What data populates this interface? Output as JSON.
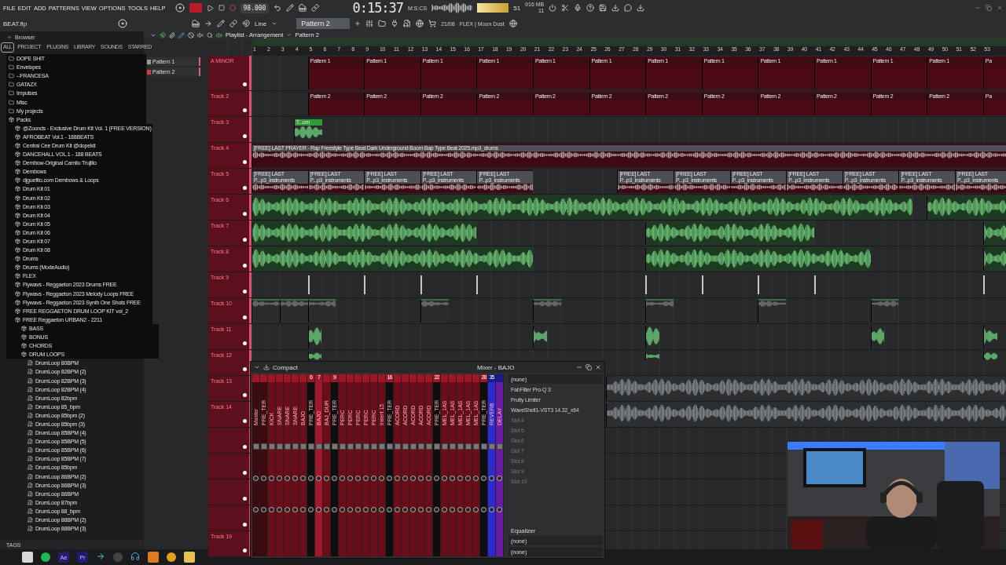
{
  "menu": [
    "FILE",
    "EDIT",
    "ADD",
    "PATTERNS",
    "VIEW",
    "OPTIONS",
    "TOOLS",
    "HELP"
  ],
  "tempo": "98.000",
  "time": "0:15:37",
  "time_unit": "M:S:CS",
  "cpu": "51",
  "memory": "916 MB",
  "polyphony": "11",
  "project": "BEAT.flp",
  "snap": "Line",
  "pattern": "Pattern 2",
  "hint_date": "21/08",
  "hint_text": "FLEX | Moon Dust",
  "browser": {
    "title": "Browser",
    "tabs": [
      {
        "label": "ALL",
        "selected": true
      },
      {
        "label": "PROJECT",
        "selected": false
      },
      {
        "label": "PLUGINS",
        "selected": false
      },
      {
        "label": "LIBRARY",
        "selected": false
      },
      {
        "label": "SOUNDS",
        "selected": false
      },
      {
        "label": "STARRED",
        "selected": false
      }
    ],
    "tree": [
      {
        "label": "DOPE SHIT",
        "kind": "folder"
      },
      {
        "label": "Envelopes",
        "kind": "folder"
      },
      {
        "label": "--FRANCESA",
        "kind": "folder"
      },
      {
        "label": "GATAZX",
        "kind": "folder"
      },
      {
        "label": "Impulses",
        "kind": "folder"
      },
      {
        "label": "Misc",
        "kind": "folder"
      },
      {
        "label": "My projects",
        "kind": "folder"
      },
      {
        "label": "Packs",
        "kind": "pack",
        "children": [
          {
            "label": "@Zounds - Exclusive Drum Kit Vol. 1 (FREE VERSION)",
            "kind": "pack"
          },
          {
            "label": "AFROBEAT Vol.1 - 188BEATS",
            "kind": "pack"
          },
          {
            "label": "Central Cee Drum Kit @dopekit",
            "kind": "pack"
          },
          {
            "label": "DANCEHALL VOL.1 - 188 BEATS",
            "kind": "pack"
          },
          {
            "label": "Dembow-Original Camilo Trujillo",
            "kind": "pack"
          },
          {
            "label": "Dembows",
            "kind": "pack"
          },
          {
            "label": "djguefito.com Dembows & Loops",
            "kind": "pack"
          },
          {
            "label": "Drum Kit 01",
            "kind": "pack"
          },
          {
            "label": "Drum Kit 02",
            "kind": "pack"
          },
          {
            "label": "Drum Kit 03",
            "kind": "pack"
          },
          {
            "label": "Drum Kit 04",
            "kind": "pack"
          },
          {
            "label": "Drum Kit 05",
            "kind": "pack"
          },
          {
            "label": "Drum Kit 06",
            "kind": "pack"
          },
          {
            "label": "Drum Kit 07",
            "kind": "pack"
          },
          {
            "label": "Drum Kit 08",
            "kind": "pack"
          },
          {
            "label": "Drums",
            "kind": "pack"
          },
          {
            "label": "Drums (ModeAudio)",
            "kind": "pack"
          },
          {
            "label": "FLEX",
            "kind": "pack"
          },
          {
            "label": "Flywavs - Reggaeton 2023 Drums FREE",
            "kind": "pack"
          },
          {
            "label": "Flywavs - Reggaeton 2023 Melody Loops FREE",
            "kind": "pack"
          },
          {
            "label": "Flywavs - Reggaeton 2023 Synth One Shots FREE",
            "kind": "pack"
          },
          {
            "label": "FREE REGGAETON DRUM LOOP KIT vol_2",
            "kind": "pack"
          },
          {
            "label": "FREE Reggaeton URBAN2 - 2211",
            "kind": "pack",
            "children": [
              {
                "label": "BASS",
                "kind": "pack"
              },
              {
                "label": "BONUS",
                "kind": "pack"
              },
              {
                "label": "CHORDS",
                "kind": "pack"
              },
              {
                "label": "DRUM LOOPS",
                "kind": "pack",
                "children": [
                  {
                    "label": "DrumLoop 80BPM",
                    "kind": "file"
                  },
                  {
                    "label": "DrumLoop 82BPM (2)",
                    "kind": "file"
                  },
                  {
                    "label": "DrumLoop 82BPM (3)",
                    "kind": "file"
                  },
                  {
                    "label": "DrumLoop 82BPM (4)",
                    "kind": "file"
                  },
                  {
                    "label": "DrumLoop 82bpm",
                    "kind": "file"
                  },
                  {
                    "label": "DrumLoop 85_bpm",
                    "kind": "file"
                  },
                  {
                    "label": "DrumLoop 85bpm (2)",
                    "kind": "file"
                  },
                  {
                    "label": "DrumLoop 85bpm (3)",
                    "kind": "file"
                  },
                  {
                    "label": "DrumLoop 85BPM (4)",
                    "kind": "file"
                  },
                  {
                    "label": "DrumLoop 85BPM (5)",
                    "kind": "file"
                  },
                  {
                    "label": "DrumLoop 85BPM (6)",
                    "kind": "file"
                  },
                  {
                    "label": "DrumLoop 85BPM (7)",
                    "kind": "file"
                  },
                  {
                    "label": "DrumLoop 85bpm",
                    "kind": "file"
                  },
                  {
                    "label": "DrumLoop 86BPM (2)",
                    "kind": "file"
                  },
                  {
                    "label": "DrumLoop 86BPM (3)",
                    "kind": "file"
                  },
                  {
                    "label": "DrumLoop 86BPM",
                    "kind": "file"
                  },
                  {
                    "label": "DrumLoop 87bpm",
                    "kind": "file"
                  },
                  {
                    "label": "DrumLoop 88_bpm",
                    "kind": "file"
                  },
                  {
                    "label": "DrumLoop 88BPM (2)",
                    "kind": "file"
                  },
                  {
                    "label": "DrumLoop 88BPM (3)",
                    "kind": "file"
                  }
                ]
              }
            ]
          }
        ]
      }
    ],
    "footer": "TAGS"
  },
  "playlist": {
    "title": "Playlist - Arrangement",
    "pattern": "Pattern 2",
    "patterns": [
      {
        "label": "Pattern 1",
        "selected": false
      },
      {
        "label": "Pattern 2",
        "selected": true
      }
    ],
    "ruler": [
      "1",
      "2",
      "3",
      "4",
      "5",
      "6",
      "7",
      "8",
      "9",
      "10",
      "11",
      "12",
      "13",
      "14",
      "15",
      "16",
      "17",
      "18",
      "19",
      "20",
      "21",
      "22",
      "23",
      "24",
      "25",
      "26",
      "27",
      "28",
      "29",
      "30",
      "31",
      "32",
      "33",
      "34",
      "35",
      "36",
      "37",
      "38",
      "39",
      "40",
      "41",
      "42",
      "43",
      "44",
      "45",
      "46",
      "47",
      "48",
      "49",
      "50",
      "51",
      "52",
      "53"
    ],
    "tracks": [
      {
        "name": "A MINOR",
        "clips": [
          {
            "kind": "pattern",
            "label": "Pattern 1"
          },
          {
            "kind": "pattern",
            "label": "Pattern 1"
          },
          {
            "kind": "pattern",
            "label": "Pattern 1"
          },
          {
            "kind": "pattern",
            "label": "Pattern 1"
          },
          {
            "kind": "pattern",
            "label": "Pattern 1"
          },
          {
            "kind": "pattern",
            "label": "Pattern 1"
          },
          {
            "kind": "pattern",
            "label": "Pattern 1"
          },
          {
            "kind": "pattern",
            "label": "Pattern 1"
          },
          {
            "kind": "pattern",
            "label": "Pattern 1"
          },
          {
            "kind": "pattern",
            "label": "Pattern 1"
          },
          {
            "kind": "pattern",
            "label": "Pattern 1"
          },
          {
            "kind": "pattern",
            "label": "Pattern 1"
          },
          {
            "kind": "pattern",
            "label": "Pa"
          }
        ]
      },
      {
        "name": "Track 2",
        "clips": [
          {
            "kind": "pattern",
            "label": "Pattern 2"
          },
          {
            "kind": "pattern",
            "label": "Pattern 2"
          },
          {
            "kind": "pattern",
            "label": "Pattern 2"
          },
          {
            "kind": "pattern",
            "label": "Pattern 2"
          },
          {
            "kind": "pattern",
            "label": "Pattern 2"
          },
          {
            "kind": "pattern",
            "label": "Pattern 2"
          },
          {
            "kind": "pattern",
            "label": "Pattern 2"
          },
          {
            "kind": "pattern",
            "label": "Pattern 2"
          },
          {
            "kind": "pattern",
            "label": "Pattern 2"
          },
          {
            "kind": "pattern",
            "label": "Pattern 2"
          },
          {
            "kind": "pattern",
            "label": "Pattern 2"
          },
          {
            "kind": "pattern",
            "label": "Pattern 2"
          },
          {
            "kind": "pattern",
            "label": "Pa"
          }
        ]
      },
      {
        "name": "Track 3",
        "clips": [
          {
            "kind": "shot",
            "label": "T...um"
          }
        ]
      },
      {
        "name": "Track 4",
        "clips": [
          {
            "kind": "audio",
            "label": "[FREE] LAST PRAYER - Rap Freestyle Type Beat  Dark Underground Boom Bap Type Beat 2025.mp3_drums"
          }
        ]
      },
      {
        "name": "Track 5",
        "clips": [
          {
            "kind": "audio",
            "label": "[FREE] LAST P...p3_instruments"
          },
          {
            "kind": "audio",
            "label": "[FREE] LAST P...p3_instruments"
          },
          {
            "kind": "audio",
            "label": "[FREE] LAST P...p3_instruments"
          },
          {
            "kind": "audio",
            "label": "[FREE] LAST P...p3_instruments"
          },
          {
            "kind": "audio",
            "label": "[FREE] LAST P...p3_instruments"
          },
          {
            "kind": "audio",
            "label": "[FREE] LAST P...p3_instruments"
          },
          {
            "kind": "audio",
            "label": "[FREE] LAST P...p3_instruments"
          },
          {
            "kind": "audio",
            "label": "[FREE] LAST P...p3_instruments"
          },
          {
            "kind": "audio",
            "label": "[FREE] LAST P...p3_instruments"
          },
          {
            "kind": "audio",
            "label": "[FREE] LAST P...p3_instruments"
          },
          {
            "kind": "audio",
            "label": "[FREE] LAST P...p3_instruments"
          },
          {
            "kind": "audio",
            "label": "[FREE] LAST P...p3_instruments"
          }
        ]
      },
      {
        "name": "Track 6",
        "clips": [
          {
            "kind": "loop"
          },
          {
            "kind": "loop"
          }
        ]
      },
      {
        "name": "Track 7",
        "clips": [
          {
            "kind": "loop"
          },
          {
            "kind": "loop"
          },
          {
            "kind": "loop"
          }
        ]
      },
      {
        "name": "Track 8",
        "clips": [
          {
            "kind": "loop"
          },
          {
            "kind": "loop"
          },
          {
            "kind": "loop"
          }
        ]
      },
      {
        "name": "Track 9",
        "clips": [
          {
            "kind": "marker"
          },
          {
            "kind": "marker"
          },
          {
            "kind": "marker"
          },
          {
            "kind": "marker"
          },
          {
            "kind": "marker"
          },
          {
            "kind": "marker"
          },
          {
            "kind": "marker"
          },
          {
            "kind": "marker"
          },
          {
            "kind": "marker"
          }
        ]
      },
      {
        "name": "Track 10",
        "clips": [
          {
            "kind": "short"
          },
          {
            "kind": "short"
          },
          {
            "kind": "short"
          },
          {
            "kind": "short"
          },
          {
            "kind": "short"
          },
          {
            "kind": "short"
          },
          {
            "kind": "short"
          },
          {
            "kind": "short"
          }
        ]
      },
      {
        "name": "Track 11",
        "clips": [
          {
            "kind": "shot"
          },
          {
            "kind": "shot"
          },
          {
            "kind": "shot"
          },
          {
            "kind": "shot"
          },
          {
            "kind": "shot"
          }
        ]
      },
      {
        "name": "Track 12",
        "clips": [
          {
            "kind": "hit"
          },
          {
            "kind": "hit"
          },
          {
            "kind": "hit"
          }
        ]
      },
      {
        "name": "Track 13",
        "clips": [
          {
            "kind": "wave"
          }
        ]
      },
      {
        "name": "Track 14",
        "clips": [
          {
            "kind": "wave"
          }
        ]
      },
      {
        "enabled": true
      },
      {
        "enabled": true
      },
      {
        "enabled": true
      },
      {
        "enabled": true
      },
      {
        "name": "Track 19",
        "enabled": true
      }
    ]
  },
  "mixer": {
    "title": "Mixer - BAJO",
    "view": "Compact",
    "strips": [
      {
        "name": "Master",
        "kind": "master",
        "selected": false
      },
      {
        "name": "PRE_TER",
        "kind": "master",
        "selected": false
      },
      {
        "name": "KICK",
        "kind": "insert",
        "selected": false
      },
      {
        "name": "SNARE",
        "kind": "insert",
        "selected": false
      },
      {
        "name": "SNARE",
        "kind": "insert",
        "selected": false
      },
      {
        "name": "SNARE",
        "kind": "insert",
        "selected": false
      },
      {
        "name": "BAJO",
        "kind": "insert",
        "selected": false
      },
      {
        "name": "PRE_TER",
        "number": "6",
        "kind": "bus",
        "selected": false
      },
      {
        "name": "BAJO",
        "number": "7",
        "kind": "insert",
        "selected": true
      },
      {
        "name": "BAJ_DUR",
        "kind": "insert",
        "selected": false
      },
      {
        "name": "PRE_TER",
        "number": "9",
        "kind": "bus",
        "selected": false
      },
      {
        "name": "PERC",
        "kind": "insert",
        "selected": false
      },
      {
        "name": "PERC",
        "kind": "insert",
        "selected": false
      },
      {
        "name": "PERC",
        "kind": "insert",
        "selected": false
      },
      {
        "name": "PERC",
        "kind": "insert",
        "selected": false
      },
      {
        "name": "PERC",
        "kind": "insert",
        "selected": false
      },
      {
        "name": "Insert 15",
        "kind": "insert",
        "selected": false
      },
      {
        "name": "PRE_TER",
        "number": "16",
        "kind": "bus",
        "selected": false
      },
      {
        "name": "ACORD",
        "kind": "insert",
        "selected": false
      },
      {
        "name": "ACORD",
        "kind": "insert",
        "selected": false
      },
      {
        "name": "ACORD",
        "kind": "insert",
        "selected": false
      },
      {
        "name": "ACORD",
        "kind": "insert",
        "selected": false
      },
      {
        "name": "ACORD",
        "kind": "insert",
        "selected": false
      },
      {
        "name": "PRE_TER",
        "number": "22",
        "kind": "bus",
        "selected": false
      },
      {
        "name": "MEL_1AS",
        "kind": "insert",
        "selected": false
      },
      {
        "name": "MEL_1AS",
        "kind": "insert",
        "selected": false
      },
      {
        "name": "MEL_1AS",
        "kind": "insert",
        "selected": false
      },
      {
        "name": "MEL_1AS",
        "kind": "insert",
        "selected": false
      },
      {
        "name": "MEL_1AS",
        "kind": "insert",
        "selected": false
      },
      {
        "name": "PRE_TER",
        "number": "28",
        "kind": "bus",
        "selected": false
      },
      {
        "name": "REVERB",
        "number": "35",
        "kind": "return",
        "color": "#2a2ad0",
        "selected": false
      },
      {
        "name": "DELAY",
        "kind": "return",
        "color": "#6a1aa8",
        "selected": false
      }
    ],
    "routing": "(none)",
    "slots": [
      {
        "name": "FabFilter Pro-Q 3",
        "kind": "plugin"
      },
      {
        "name": "Fruity Limiter",
        "kind": "plugin"
      },
      {
        "name": "WaveShell1-VST3 14.32_x64",
        "kind": "plugin"
      },
      {
        "name": "Slot 4",
        "kind": "empty"
      },
      {
        "name": "Slot 5",
        "kind": "empty"
      },
      {
        "name": "Slot 6",
        "kind": "empty"
      },
      {
        "name": "Slot 7",
        "kind": "empty"
      },
      {
        "name": "Slot 8",
        "kind": "empty"
      },
      {
        "name": "Slot 9",
        "kind": "empty"
      },
      {
        "name": "Slot 10",
        "kind": "empty"
      }
    ],
    "eq_label": "Equalizer",
    "input": "(none)",
    "output": "(none)"
  },
  "taskbar": [
    {
      "kind": "windows"
    },
    {
      "kind": "spotify"
    },
    {
      "kind": "app",
      "label": "Ae",
      "color": "#2a1a6e"
    },
    {
      "kind": "app",
      "label": "Pr",
      "color": "#1e1a6e"
    },
    {
      "kind": "arrow"
    },
    {
      "kind": "obs"
    },
    {
      "kind": "headset"
    },
    {
      "kind": "fl"
    },
    {
      "kind": "chrome"
    },
    {
      "kind": "folder"
    }
  ]
}
